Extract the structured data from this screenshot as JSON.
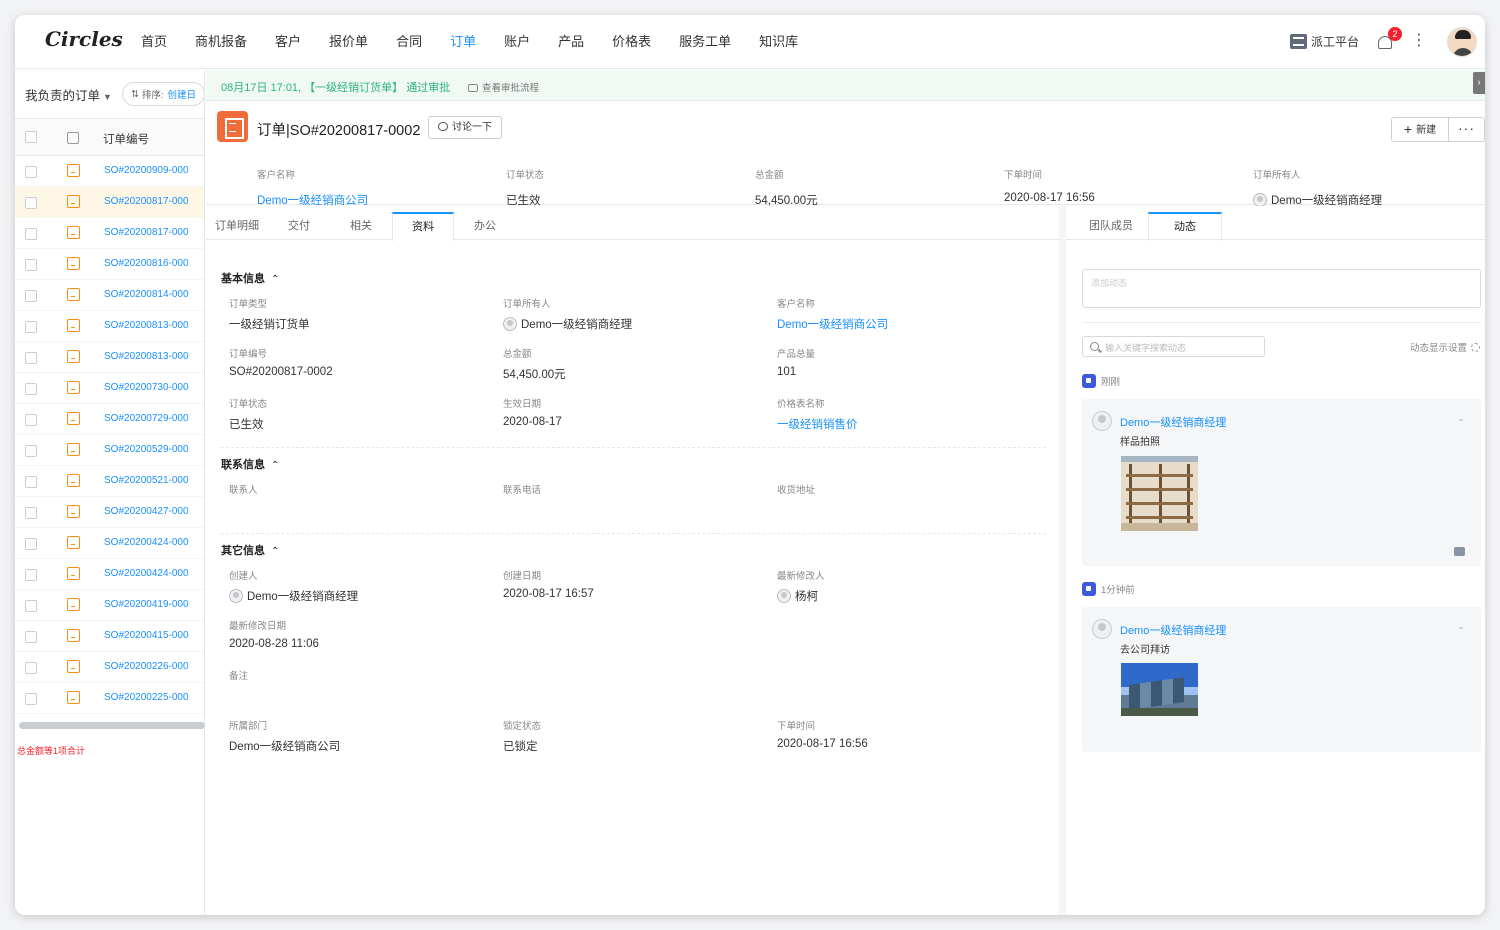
{
  "app": {
    "logo": "Circles",
    "nav": [
      "首页",
      "商机报备",
      "客户",
      "报价单",
      "合同",
      "订单",
      "账户",
      "产品",
      "价格表",
      "服务工单",
      "知识库"
    ],
    "active_nav_index": 5,
    "dispatch_label": "派工平台",
    "notification_count": "2",
    "accent": "#1890ff"
  },
  "left": {
    "title": "我负责的订单",
    "sort_label": "排序:",
    "sort_value": "创建日",
    "column_header": "订单编号",
    "orders": [
      "SO#20200909-000",
      "SO#20200817-000",
      "SO#20200817-000",
      "SO#20200816-000",
      "SO#20200814-000",
      "SO#20200813-000",
      "SO#20200813-000",
      "SO#20200730-000",
      "SO#20200729-000",
      "SO#20200529-000",
      "SO#20200521-000",
      "SO#20200427-000",
      "SO#20200424-000",
      "SO#20200424-000",
      "SO#20200419-000",
      "SO#20200415-000",
      "SO#20200226-000",
      "SO#20200225-000"
    ],
    "selected_index": 1,
    "total_note": "总金额等1项合计"
  },
  "banner": {
    "text": "08月17日 17:01, 【一级经销订货单】 通过审批",
    "link": "查看审批流程"
  },
  "header": {
    "title": "订单|SO#20200817-0002",
    "discuss_label": "讨论一下",
    "new_label": "新建",
    "more_label": "···",
    "fields": [
      {
        "label": "客户名称",
        "value": "Demo一级经销商公司",
        "link": true,
        "avatar": false
      },
      {
        "label": "订单状态",
        "value": "已生效",
        "link": false,
        "avatar": false
      },
      {
        "label": "总金额",
        "value": "54,450.00元",
        "link": false,
        "avatar": false
      },
      {
        "label": "下单时间",
        "value": "2020-08-17 16:56",
        "link": false,
        "avatar": false
      },
      {
        "label": "订单所有人",
        "value": "Demo一级经销商经理",
        "link": false,
        "avatar": true
      }
    ]
  },
  "tabs": [
    "订单明细",
    "交付",
    "相关",
    "资料",
    "办公"
  ],
  "active_tab_index": 3,
  "sections": {
    "basic": {
      "title": "基本信息",
      "fields": {
        "order_type": {
          "label": "订单类型",
          "value": "一级经销订货单"
        },
        "owner": {
          "label": "订单所有人",
          "value": "Demo一级经销商经理"
        },
        "customer": {
          "label": "客户名称",
          "value": "Demo一级经销商公司"
        },
        "order_no": {
          "label": "订单编号",
          "value": "SO#20200817-0002"
        },
        "total": {
          "label": "总金额",
          "value": "54,450.00元"
        },
        "product_qty": {
          "label": "产品总量",
          "value": "101"
        },
        "status": {
          "label": "订单状态",
          "value": "已生效"
        },
        "effective_date": {
          "label": "生效日期",
          "value": "2020-08-17"
        },
        "price_list": {
          "label": "价格表名称",
          "value": "一级经销销售价"
        }
      }
    },
    "contact": {
      "title": "联系信息",
      "fields": {
        "contact": {
          "label": "联系人",
          "value": ""
        },
        "phone": {
          "label": "联系电话",
          "value": ""
        },
        "address": {
          "label": "收货地址",
          "value": ""
        }
      }
    },
    "other": {
      "title": "其它信息",
      "fields": {
        "creator": {
          "label": "创建人",
          "value": "Demo一级经销商经理"
        },
        "created_date": {
          "label": "创建日期",
          "value": "2020-08-17 16:57"
        },
        "modifier": {
          "label": "最新修改人",
          "value": "杨柯"
        },
        "modified_date": {
          "label": "最新修改日期",
          "value": "2020-08-28 11:06"
        },
        "remark": {
          "label": "备注",
          "value": ""
        },
        "department": {
          "label": "所属部门",
          "value": "Demo一级经销商公司"
        },
        "lock_status": {
          "label": "锁定状态",
          "value": "已锁定"
        },
        "order_time": {
          "label": "下单时间",
          "value": "2020-08-17 16:56"
        }
      }
    }
  },
  "right": {
    "tabs": [
      "团队成员",
      "动态"
    ],
    "active_tab_index": 1,
    "post_placeholder": "添加动态",
    "search_placeholder": "输入关键字搜索动态",
    "display_settings": "动态显示设置",
    "feeds": [
      {
        "time": "刚刚",
        "author": "Demo一级经销商经理",
        "text": "样品拍照",
        "photo": "shelf"
      },
      {
        "time": "1分钟前",
        "author": "Demo一级经销商经理",
        "text": "去公司拜访",
        "photo": "building"
      }
    ]
  }
}
